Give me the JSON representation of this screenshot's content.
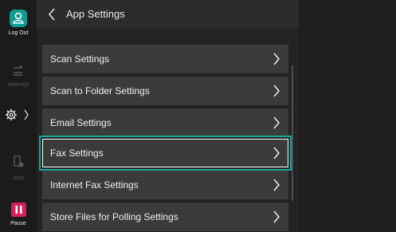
{
  "rail": {
    "logout_label": "Log Out",
    "interrupt_label": "Interrupt",
    "jobs_label": "Jobs",
    "pause_label": "Pause",
    "settings_chevron": "〉"
  },
  "header": {
    "title": "App Settings"
  },
  "list": {
    "items": [
      {
        "label": "Scan Settings"
      },
      {
        "label": "Scan to Folder Settings"
      },
      {
        "label": "Email Settings"
      },
      {
        "label": "Fax Settings",
        "selected": true
      },
      {
        "label": "Internet Fax Settings"
      },
      {
        "label": "Store Files for Polling Settings"
      }
    ]
  },
  "colors": {
    "accent": "#1aa69a",
    "logout": "#0f9c93",
    "pause": "#d8205a",
    "item_bg": "#3b3b3b"
  },
  "icons": {
    "logout": "user-icon",
    "interrupt": "interrupt-icon",
    "settings": "gear-icon",
    "jobs": "jobs-icon",
    "pause": "pause-icon",
    "back": "chevron-left-icon",
    "row": "chevron-right-icon"
  }
}
